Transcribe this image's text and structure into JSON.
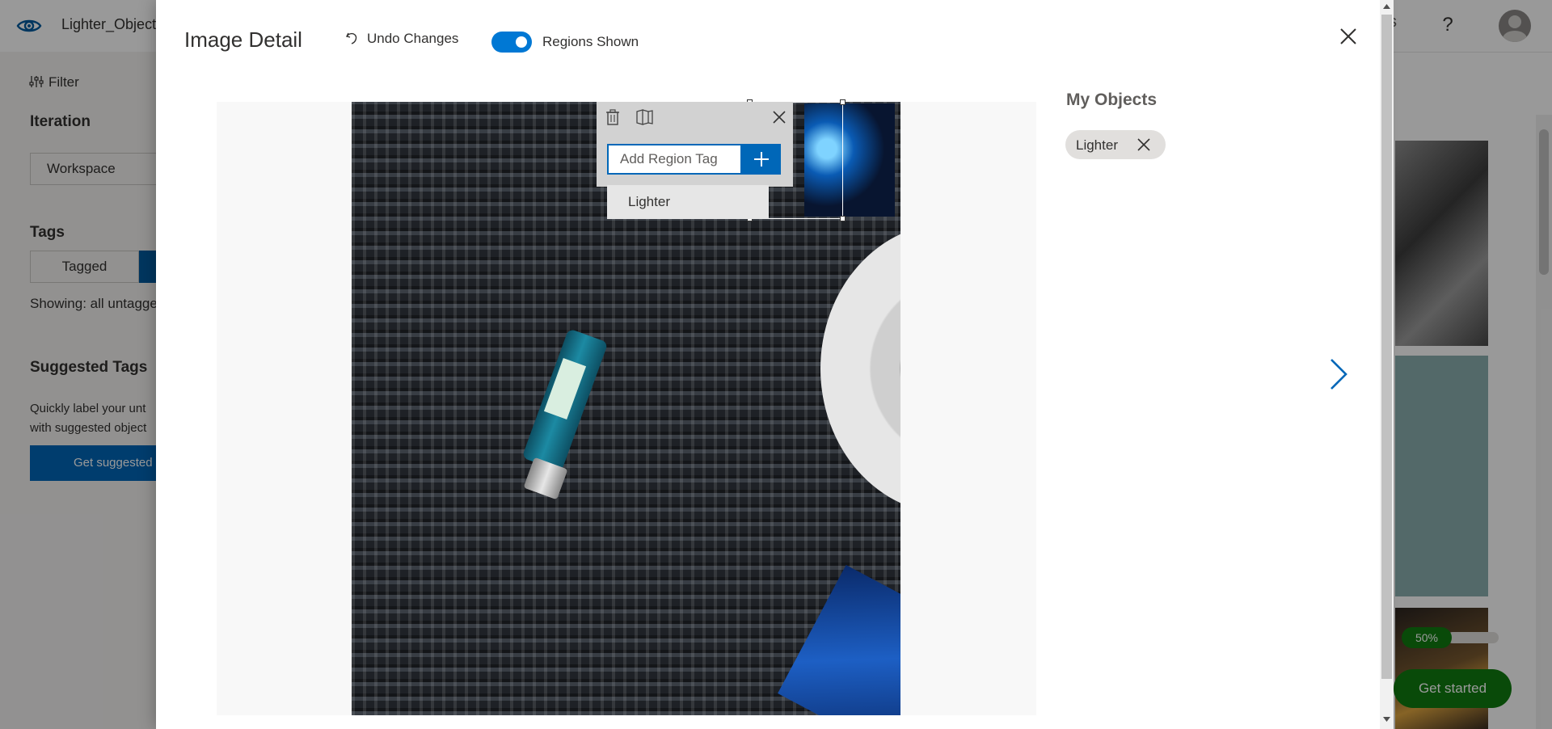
{
  "app": {
    "name": "Lighter_Object",
    "top_partial": "s",
    "help_icon": "?"
  },
  "sidebar": {
    "filter_label": "Filter",
    "iteration_heading": "Iteration",
    "iteration_value": "Workspace",
    "tags_heading": "Tags",
    "tagged_label": "Tagged",
    "showing_text": "Showing: all untagge",
    "suggested_heading": "Suggested Tags",
    "suggested_desc_line1": "Quickly label your unt",
    "suggested_desc_line2": "with suggested object",
    "get_suggested_label": "Get suggested"
  },
  "background_right": {
    "progress_label": "50%",
    "progress_value": 0.5,
    "get_started_label": "Get started"
  },
  "modal": {
    "title": "Image Detail",
    "undo_label": "Undo Changes",
    "regions_toggle_label": "Regions Shown",
    "regions_toggle_on": true,
    "region_editor": {
      "input_placeholder": "Add Region Tag",
      "input_value": "",
      "suggestion": "Lighter",
      "icons": [
        "trash-icon",
        "copy-region-icon",
        "close-icon",
        "plus-icon"
      ]
    },
    "objects_heading": "My Objects",
    "object_tags": [
      "Lighter"
    ]
  },
  "colors": {
    "accent": "#0078d4",
    "primary_button": "#0067b8",
    "success": "#107c10",
    "modal_overlay": "#000000"
  }
}
